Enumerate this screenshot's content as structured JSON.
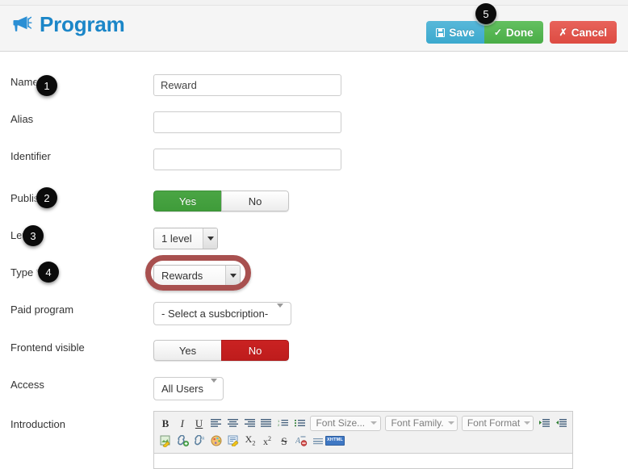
{
  "header": {
    "title": "Program",
    "icon": "megaphone-icon",
    "buttons": {
      "save": "Save",
      "done": "Done",
      "cancel": "Cancel",
      "save_icon": "floppy-disk-icon",
      "done_icon": "check-icon",
      "cancel_icon": "cross-icon"
    },
    "accent_color": "#1b86c8",
    "save_color": "#3ba9ce",
    "done_color": "#4aad47",
    "cancel_color": "#dd4b42"
  },
  "badges": [
    {
      "number": "1",
      "target": "name-field"
    },
    {
      "number": "2",
      "target": "publish-toggle"
    },
    {
      "number": "3",
      "target": "level-select"
    },
    {
      "number": "4",
      "target": "type-select"
    },
    {
      "number": "5",
      "target": "save-done-buttons"
    }
  ],
  "highlight": {
    "color": "#a8504f",
    "target": "type-select"
  },
  "form": {
    "rows": [
      {
        "label": "Name",
        "type": "text",
        "value": "Reward",
        "placeholder": ""
      },
      {
        "label": "Alias",
        "type": "text",
        "value": "",
        "placeholder": ""
      },
      {
        "label": "Identifier",
        "type": "text",
        "value": "",
        "placeholder": ""
      },
      {
        "label": "Publish",
        "type": "toggle",
        "options": [
          "Yes",
          "No"
        ],
        "selected": "Yes",
        "selected_color": "#3f9c3a"
      },
      {
        "label": "Level",
        "type": "native-select",
        "value": "1 level"
      },
      {
        "label": "Type *",
        "type": "native-select",
        "value": "Rewards"
      },
      {
        "label": "Paid program",
        "type": "chosen-select",
        "value": "- Select a susbcription-"
      },
      {
        "label": "Frontend visible",
        "type": "toggle",
        "options": [
          "Yes",
          "No"
        ],
        "selected": "No",
        "selected_color": "#be1c1c"
      },
      {
        "label": "Access",
        "type": "chosen-select",
        "value": "All Users"
      },
      {
        "label": "Introduction",
        "type": "richtext"
      }
    ]
  },
  "editor": {
    "toolbar_row1": [
      {
        "name": "bold-icon",
        "glyph": "B"
      },
      {
        "name": "italic-icon",
        "glyph": "I"
      },
      {
        "name": "underline-icon",
        "glyph": "U"
      },
      {
        "name": "align-left-icon",
        "glyph": "≡"
      },
      {
        "name": "align-center-icon",
        "glyph": "≡"
      },
      {
        "name": "align-right-icon",
        "glyph": "≡"
      },
      {
        "name": "align-justify-icon",
        "glyph": "≡"
      },
      {
        "name": "ordered-list-icon",
        "glyph": "≣"
      },
      {
        "name": "unordered-list-icon",
        "glyph": "≣"
      }
    ],
    "selects": [
      {
        "name": "font-size-select",
        "label": "Font Size..."
      },
      {
        "name": "font-family-select",
        "label": "Font Family."
      },
      {
        "name": "font-format-select",
        "label": "Font Format"
      }
    ],
    "toolbar_row1_end": [
      {
        "name": "outdent-icon",
        "glyph": "≡"
      },
      {
        "name": "indent-icon",
        "glyph": "≡"
      }
    ],
    "toolbar_row2": [
      {
        "name": "insert-image-icon",
        "glyph": "✎"
      },
      {
        "name": "insert-link-icon",
        "glyph": "⚭"
      },
      {
        "name": "unlink-icon",
        "glyph": "⚮"
      },
      {
        "name": "text-color-icon",
        "glyph": "◐"
      },
      {
        "name": "edit-source-icon",
        "glyph": "✏"
      },
      {
        "name": "subscript-icon",
        "glyph": "X"
      },
      {
        "name": "superscript-icon",
        "glyph": "x"
      },
      {
        "name": "strikethrough-icon",
        "glyph": "S"
      },
      {
        "name": "remove-format-icon",
        "glyph": "A"
      },
      {
        "name": "horizontal-rule-icon",
        "glyph": "≡"
      },
      {
        "name": "xhtml-source-icon",
        "glyph": "XHTML"
      }
    ]
  }
}
